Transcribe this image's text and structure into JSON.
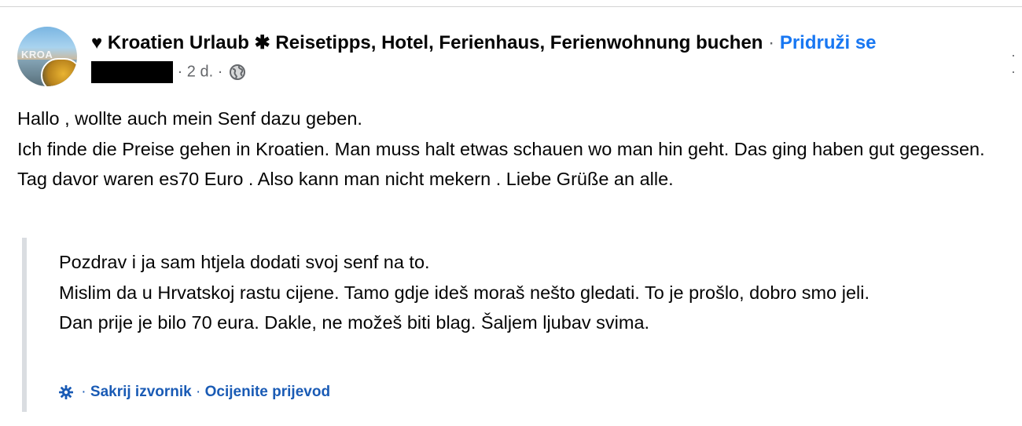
{
  "header": {
    "group_name": "♥ Kroatien Urlaub ✱ Reisetipps, Hotel, Ferienhaus, Ferienwohnung buchen",
    "separator": "·",
    "join_label": "Pridruži se",
    "avatar_text": "KROA",
    "more_label": "·  ·",
    "meta_time": "· 2 d. ·"
  },
  "post": {
    "lines": [
      "Hallo , wollte auch mein Senf dazu geben.",
      "Ich finde die Preise gehen in Kroatien. Man muss halt etwas schauen wo man hin geht. Das ging haben gut gegessen.",
      "Tag davor waren es70 Euro . Also kann man nicht mekern . Liebe Grüße an alle."
    ]
  },
  "translation": {
    "lines": [
      "Pozdrav i ja sam htjela dodati svoj senf na to.",
      "Mislim da u Hrvatskoj rastu cijene. Tamo gdje ideš moraš nešto gledati. To je prošlo, dobro smo jeli.",
      "Dan prije je bilo 70 eura. Dakle, ne možeš biti blag. Šaljem ljubav svima."
    ],
    "sep": "·",
    "hide_original": "Sakrij izvornik",
    "rate_translation": "Ocijenite prijevod"
  },
  "icons": {
    "privacy": "globe-icon",
    "settings": "gear-icon"
  },
  "colors": {
    "link": "#1877f2",
    "text": "#050505",
    "secondary": "#65676b"
  }
}
